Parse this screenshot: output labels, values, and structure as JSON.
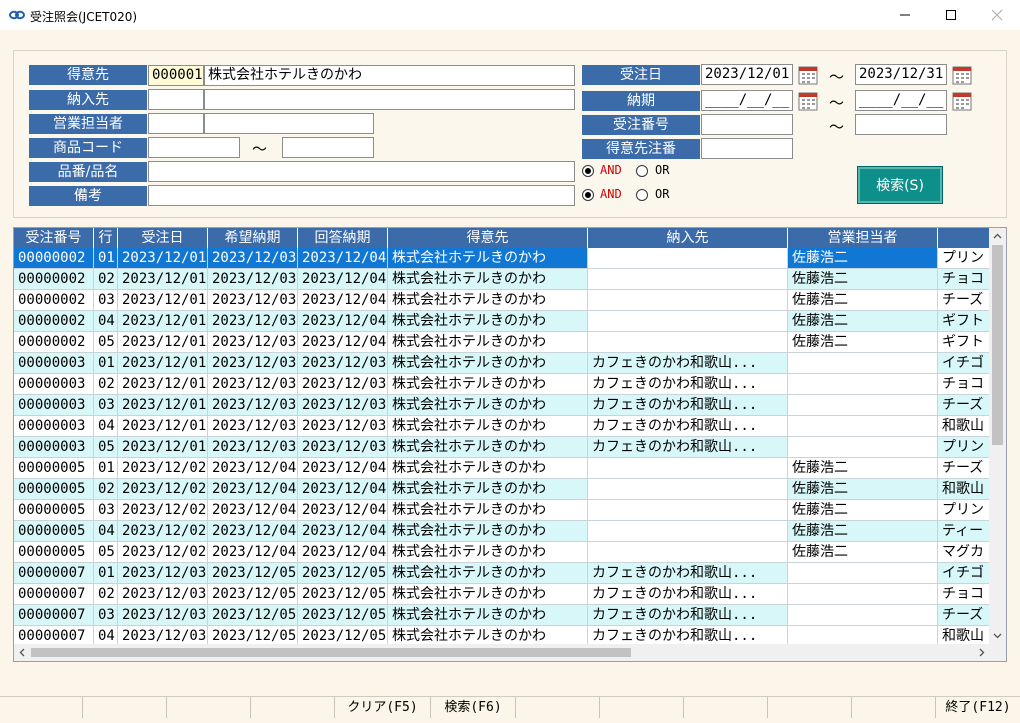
{
  "window": {
    "title": "受注照会(JCET020)"
  },
  "filters": {
    "customer_label": "得意先",
    "customer_code": "000001",
    "customer_name": "株式会社ホテルきのかわ",
    "delivery_label": "納入先",
    "staff_label": "営業担当者",
    "product_code_label": "商品コード",
    "product_name_label": "品番/品名",
    "remarks_label": "備考",
    "order_date_label": "受注日",
    "order_date_from": "2023/12/01",
    "order_date_to": "2023/12/31",
    "due_label": "納期",
    "due_from": "____/__/__",
    "due_to": "____/__/__",
    "order_no_label": "受注番号",
    "cust_order_no_label": "得意先注番",
    "tilde": "～",
    "and_label": "AND",
    "or_label": "OR",
    "search_label": "検索(S)"
  },
  "grid": {
    "columns": [
      "受注番号",
      "行",
      "受注日",
      "希望納期",
      "回答納期",
      "得意先",
      "納入先",
      "営業担当者",
      ""
    ],
    "rows": [
      [
        "00000002",
        "01",
        "2023/12/01",
        "2023/12/03",
        "2023/12/04",
        "株式会社ホテルきのかわ",
        "",
        "佐藤浩二",
        "プリン"
      ],
      [
        "00000002",
        "02",
        "2023/12/01",
        "2023/12/03",
        "2023/12/04",
        "株式会社ホテルきのかわ",
        "",
        "佐藤浩二",
        "チョコ"
      ],
      [
        "00000002",
        "03",
        "2023/12/01",
        "2023/12/03",
        "2023/12/04",
        "株式会社ホテルきのかわ",
        "",
        "佐藤浩二",
        "チーズ"
      ],
      [
        "00000002",
        "04",
        "2023/12/01",
        "2023/12/03",
        "2023/12/04",
        "株式会社ホテルきのかわ",
        "",
        "佐藤浩二",
        "ギフト"
      ],
      [
        "00000002",
        "05",
        "2023/12/01",
        "2023/12/03",
        "2023/12/04",
        "株式会社ホテルきのかわ",
        "",
        "佐藤浩二",
        "ギフト"
      ],
      [
        "00000003",
        "01",
        "2023/12/01",
        "2023/12/03",
        "2023/12/03",
        "株式会社ホテルきのかわ",
        "カフェきのかわ和歌山...",
        "",
        "イチゴ"
      ],
      [
        "00000003",
        "02",
        "2023/12/01",
        "2023/12/03",
        "2023/12/03",
        "株式会社ホテルきのかわ",
        "カフェきのかわ和歌山...",
        "",
        "チョコ"
      ],
      [
        "00000003",
        "03",
        "2023/12/01",
        "2023/12/03",
        "2023/12/03",
        "株式会社ホテルきのかわ",
        "カフェきのかわ和歌山...",
        "",
        "チーズ"
      ],
      [
        "00000003",
        "04",
        "2023/12/01",
        "2023/12/03",
        "2023/12/03",
        "株式会社ホテルきのかわ",
        "カフェきのかわ和歌山...",
        "",
        "和歌山"
      ],
      [
        "00000003",
        "05",
        "2023/12/01",
        "2023/12/03",
        "2023/12/03",
        "株式会社ホテルきのかわ",
        "カフェきのかわ和歌山...",
        "",
        "プリン"
      ],
      [
        "00000005",
        "01",
        "2023/12/02",
        "2023/12/04",
        "2023/12/04",
        "株式会社ホテルきのかわ",
        "",
        "佐藤浩二",
        "チーズ"
      ],
      [
        "00000005",
        "02",
        "2023/12/02",
        "2023/12/04",
        "2023/12/04",
        "株式会社ホテルきのかわ",
        "",
        "佐藤浩二",
        "和歌山"
      ],
      [
        "00000005",
        "03",
        "2023/12/02",
        "2023/12/04",
        "2023/12/04",
        "株式会社ホテルきのかわ",
        "",
        "佐藤浩二",
        "プリン"
      ],
      [
        "00000005",
        "04",
        "2023/12/02",
        "2023/12/04",
        "2023/12/04",
        "株式会社ホテルきのかわ",
        "",
        "佐藤浩二",
        "ティー"
      ],
      [
        "00000005",
        "05",
        "2023/12/02",
        "2023/12/04",
        "2023/12/04",
        "株式会社ホテルきのかわ",
        "",
        "佐藤浩二",
        "マグカ"
      ],
      [
        "00000007",
        "01",
        "2023/12/03",
        "2023/12/05",
        "2023/12/05",
        "株式会社ホテルきのかわ",
        "カフェきのかわ和歌山...",
        "",
        "イチゴ"
      ],
      [
        "00000007",
        "02",
        "2023/12/03",
        "2023/12/05",
        "2023/12/05",
        "株式会社ホテルきのかわ",
        "カフェきのかわ和歌山...",
        "",
        "チョコ"
      ],
      [
        "00000007",
        "03",
        "2023/12/03",
        "2023/12/05",
        "2023/12/05",
        "株式会社ホテルきのかわ",
        "カフェきのかわ和歌山...",
        "",
        "チーズ"
      ],
      [
        "00000007",
        "04",
        "2023/12/03",
        "2023/12/05",
        "2023/12/05",
        "株式会社ホテルきのかわ",
        "カフェきのかわ和歌山...",
        "",
        "和歌山"
      ]
    ]
  },
  "statusbar": {
    "clear_label": "クリア(F5)",
    "search_label": "検索(F6)",
    "exit_label": "終了(F12)"
  },
  "colors": {
    "label_bg": "#3b6ba8",
    "selected_row": "#1078d4",
    "alt_row": "#d7f7f9",
    "search_button": "#0f8f8a",
    "and_text": "#d40000"
  }
}
